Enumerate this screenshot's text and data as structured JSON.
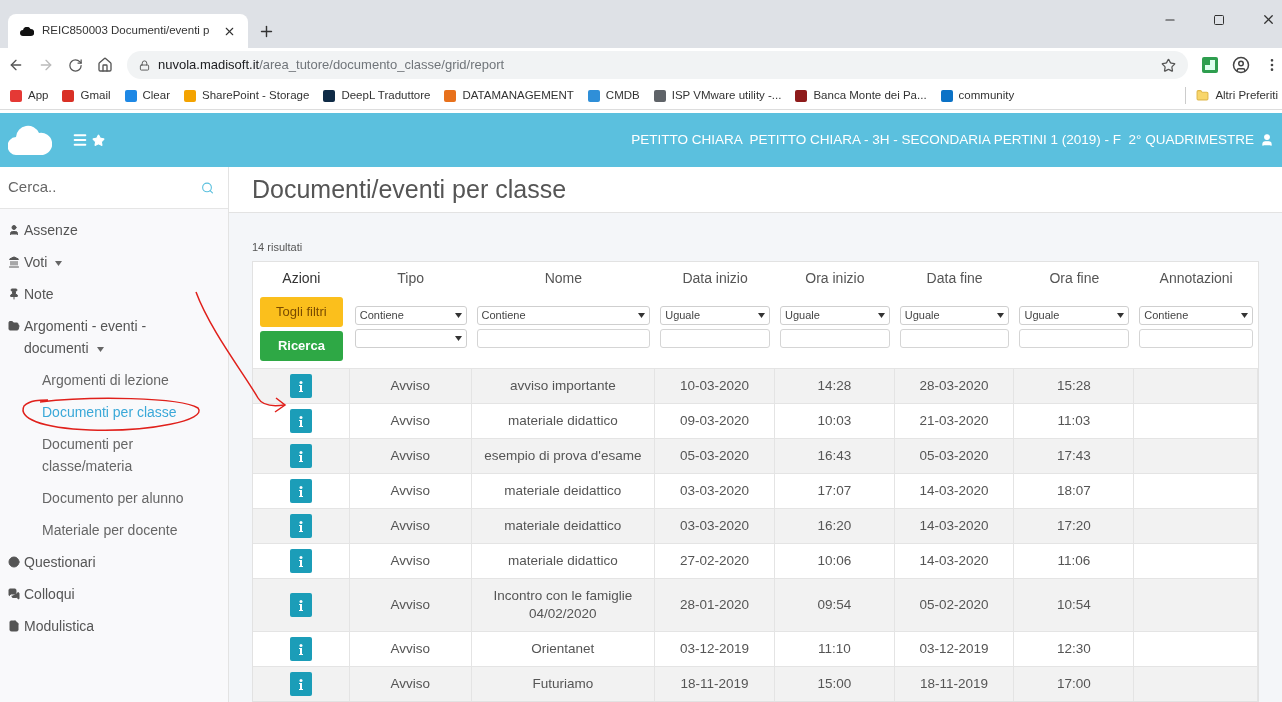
{
  "browser": {
    "tab_title": "REIC850003 Documenti/eventi p",
    "url_host": "nuvola.madisoft.it",
    "url_path": "/area_tutore/documento_classe/grid/report",
    "bookmarks": [
      {
        "label": "App",
        "color": "#e53935"
      },
      {
        "label": "Gmail",
        "color": "#d93025"
      },
      {
        "label": "Clear",
        "color": "#1e88e5"
      },
      {
        "label": "SharePoint - Storage",
        "color": "#f4a300"
      },
      {
        "label": "DeepL Traduttore",
        "color": "#0f2b46"
      },
      {
        "label": "DATAMANAGEMENT",
        "color": "#e8711c"
      },
      {
        "label": "CMDB",
        "color": "#2f8fd8"
      },
      {
        "label": "ISP VMware utility -...",
        "color": "#5f6368"
      },
      {
        "label": "Banca Monte dei Pa...",
        "color": "#8e1b1b"
      },
      {
        "label": "community",
        "color": "#0b72c6"
      }
    ],
    "other_bookmarks": "Altri Preferiti"
  },
  "header": {
    "user_info": "PETITTO CHIARA  PETITTO CHIARA - 3H - SECONDARIA PERTINI 1 (2019) - F  2° QUADRIMESTRE"
  },
  "sidebar": {
    "search_placeholder": "Cerca..",
    "items": [
      {
        "kind": "link",
        "label": "Assenze"
      },
      {
        "kind": "menu",
        "label": "Voti"
      },
      {
        "kind": "link",
        "label": "Note"
      },
      {
        "kind": "menu",
        "label": "Argomenti - eventi - documenti",
        "children": [
          {
            "label": "Argomenti di lezione",
            "selected": false
          },
          {
            "label": "Documenti per classe",
            "selected": true
          },
          {
            "label": "Documenti per classe/materia",
            "selected": false
          },
          {
            "label": "Documento per alunno",
            "selected": false
          },
          {
            "label": "Materiale per docente",
            "selected": false
          }
        ]
      },
      {
        "kind": "link",
        "label": "Questionari"
      },
      {
        "kind": "link",
        "label": "Colloqui"
      },
      {
        "kind": "link",
        "label": "Modulistica"
      }
    ]
  },
  "page": {
    "title": "Documenti/eventi per classe",
    "result_count": "14 risultati"
  },
  "table": {
    "columns": [
      "Azioni",
      "Tipo",
      "Nome",
      "Data inizio",
      "Ora inizio",
      "Data fine",
      "Ora fine",
      "Annotazioni"
    ],
    "buttons": [
      "Togli filtri",
      "Ricerca"
    ],
    "filters": [
      {
        "operator": "Contiene",
        "kind": "select"
      },
      {
        "operator": "Contiene",
        "kind": "text"
      },
      {
        "operator": "Uguale",
        "kind": "text"
      },
      {
        "operator": "Uguale",
        "kind": "text"
      },
      {
        "operator": "Uguale",
        "kind": "text"
      },
      {
        "operator": "Uguale",
        "kind": "text"
      },
      {
        "operator": "Contiene",
        "kind": "text"
      }
    ],
    "rows": [
      {
        "cells": [
          "",
          "Avviso",
          "avviso importante",
          "10-03-2020",
          "14:28",
          "28-03-2020",
          "15:28",
          ""
        ]
      },
      {
        "cells": [
          "",
          "Avviso",
          "materiale didattico",
          "09-03-2020",
          "10:03",
          "21-03-2020",
          "11:03",
          ""
        ]
      },
      {
        "cells": [
          "",
          "Avviso",
          "esempio di prova d'esame",
          "05-03-2020",
          "16:43",
          "05-03-2020",
          "17:43",
          ""
        ]
      },
      {
        "cells": [
          "",
          "Avviso",
          "materiale deidattico",
          "03-03-2020",
          "17:07",
          "14-03-2020",
          "18:07",
          ""
        ]
      },
      {
        "cells": [
          "",
          "Avviso",
          "materiale deidattico",
          "03-03-2020",
          "16:20",
          "14-03-2020",
          "17:20",
          ""
        ]
      },
      {
        "cells": [
          "",
          "Avviso",
          "materiale didattico",
          "27-02-2020",
          "10:06",
          "14-03-2020",
          "11:06",
          ""
        ]
      },
      {
        "cells": [
          "",
          "Avviso",
          "Incontro con le famiglie 04/02/2020",
          "28-01-2020",
          "09:54",
          "05-02-2020",
          "10:54",
          ""
        ]
      },
      {
        "cells": [
          "",
          "Avviso",
          "Orientanet",
          "03-12-2019",
          "11:10",
          "03-12-2019",
          "12:30",
          ""
        ]
      },
      {
        "cells": [
          "",
          "Avviso",
          "Futuriamo",
          "18-11-2019",
          "15:00",
          "18-11-2019",
          "17:00",
          ""
        ]
      }
    ]
  }
}
